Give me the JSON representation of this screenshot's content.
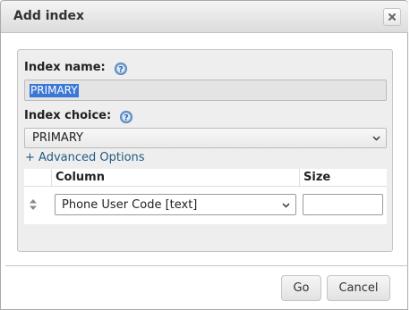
{
  "dialog": {
    "title": "Add index",
    "close_icon": "close-icon"
  },
  "form": {
    "index_name_label": "Index name:",
    "index_name_value": "PRIMARY",
    "index_choice_label": "Index choice:",
    "index_choice_value": "PRIMARY",
    "advanced_options_link": "+ Advanced Options",
    "help_icon": "help-icon"
  },
  "columns_table": {
    "headers": [
      "Column",
      "Size"
    ],
    "rows": [
      {
        "column": "Phone User Code [text]",
        "size": ""
      }
    ]
  },
  "buttons": {
    "go": "Go",
    "cancel": "Cancel"
  },
  "colors": {
    "title_bar": "#dcdcdc",
    "link": "#235a81",
    "selection": "#3b78d6",
    "panel": "#eeeeee"
  }
}
